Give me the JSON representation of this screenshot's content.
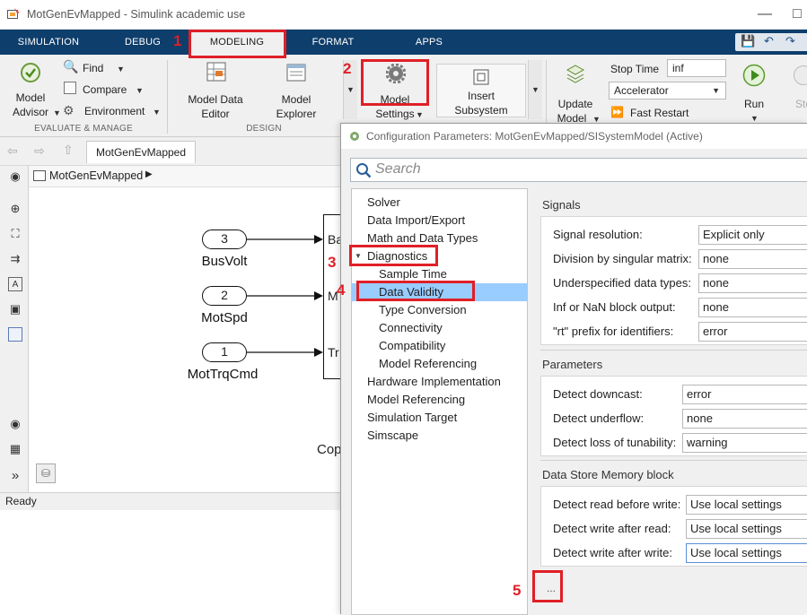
{
  "window": {
    "title": "MotGenEvMapped - Simulink academic use"
  },
  "tabs": [
    "SIMULATION",
    "DEBUG",
    "MODELING",
    "FORMAT",
    "APPS"
  ],
  "ribbon": {
    "model_advisor": [
      "Model",
      "Advisor"
    ],
    "find": "Find",
    "compare": "Compare",
    "environment": "Environment",
    "evaluate_section": "EVALUATE & MANAGE",
    "model_data_editor": [
      "Model Data",
      "Editor"
    ],
    "model_explorer": [
      "Model",
      "Explorer"
    ],
    "design_section": "DESIGN",
    "model_settings": [
      "Model",
      "Settings"
    ],
    "insert_subsystem": [
      "Insert",
      "Subsystem"
    ],
    "update_model": [
      "Update",
      "Model"
    ],
    "stop_time_label": "Stop Time",
    "stop_time_value": "inf",
    "solver_mode": "Accelerator",
    "fast_restart": "Fast Restart",
    "run": "Run",
    "stop": "Sto"
  },
  "editor": {
    "tab": "MotGenEvMapped",
    "breadcrumb": "MotGenEvMapped",
    "status": "Ready",
    "ports": [
      {
        "num": "3",
        "label": "BusVolt"
      },
      {
        "num": "2",
        "label": "MotSpd"
      },
      {
        "num": "1",
        "label": "MotTrqCmd"
      }
    ],
    "block_inputs": [
      "Ba",
      "M",
      "Tr"
    ],
    "cop_text": "Cop"
  },
  "config": {
    "title": "Configuration Parameters: MotGenEvMapped/SISystemModel (Active)",
    "search_placeholder": "Search",
    "tree": [
      {
        "label": "Solver",
        "level": 0
      },
      {
        "label": "Data Import/Export",
        "level": 0
      },
      {
        "label": "Math and Data Types",
        "level": 0
      },
      {
        "label": "Diagnostics",
        "level": 0,
        "expanded": true
      },
      {
        "label": "Sample Time",
        "level": 1
      },
      {
        "label": "Data Validity",
        "level": 1,
        "selected": true
      },
      {
        "label": "Type Conversion",
        "level": 1
      },
      {
        "label": "Connectivity",
        "level": 1
      },
      {
        "label": "Compatibility",
        "level": 1
      },
      {
        "label": "Model Referencing",
        "level": 1
      },
      {
        "label": "Hardware Implementation",
        "level": 0
      },
      {
        "label": "Model Referencing",
        "level": 0
      },
      {
        "label": "Simulation Target",
        "level": 0
      },
      {
        "label": "Simscape",
        "level": 0
      }
    ],
    "signals": {
      "title": "Signals",
      "rows": [
        {
          "label": "Signal resolution:",
          "value": "Explicit only"
        },
        {
          "label": "Division by singular matrix:",
          "value": "none"
        },
        {
          "label": "Underspecified data types:",
          "value": "none"
        },
        {
          "label": "Inf or NaN block output:",
          "value": "none"
        },
        {
          "label": "\"rt\" prefix for identifiers:",
          "value": "error"
        }
      ]
    },
    "parameters": {
      "title": "Parameters",
      "rows": [
        {
          "label": "Detect downcast:",
          "value": "error"
        },
        {
          "label": "Detect underflow:",
          "value": "none"
        },
        {
          "label": "Detect loss of tunability:",
          "value": "warning"
        }
      ]
    },
    "data_store": {
      "title": "Data Store Memory block",
      "rows": [
        {
          "label": "Detect read before write:",
          "value": "Use local settings"
        },
        {
          "label": "Detect write after read:",
          "value": "Use local settings"
        },
        {
          "label": "Detect write after write:",
          "value": "Use local settings"
        }
      ]
    },
    "more_button": "..."
  },
  "annotations": [
    "1",
    "2",
    "3",
    "4",
    "5"
  ],
  "colors": {
    "annotation": "#e01f26",
    "toolstrip": "#0e3e6b",
    "tree_selected": "#99ccff"
  }
}
